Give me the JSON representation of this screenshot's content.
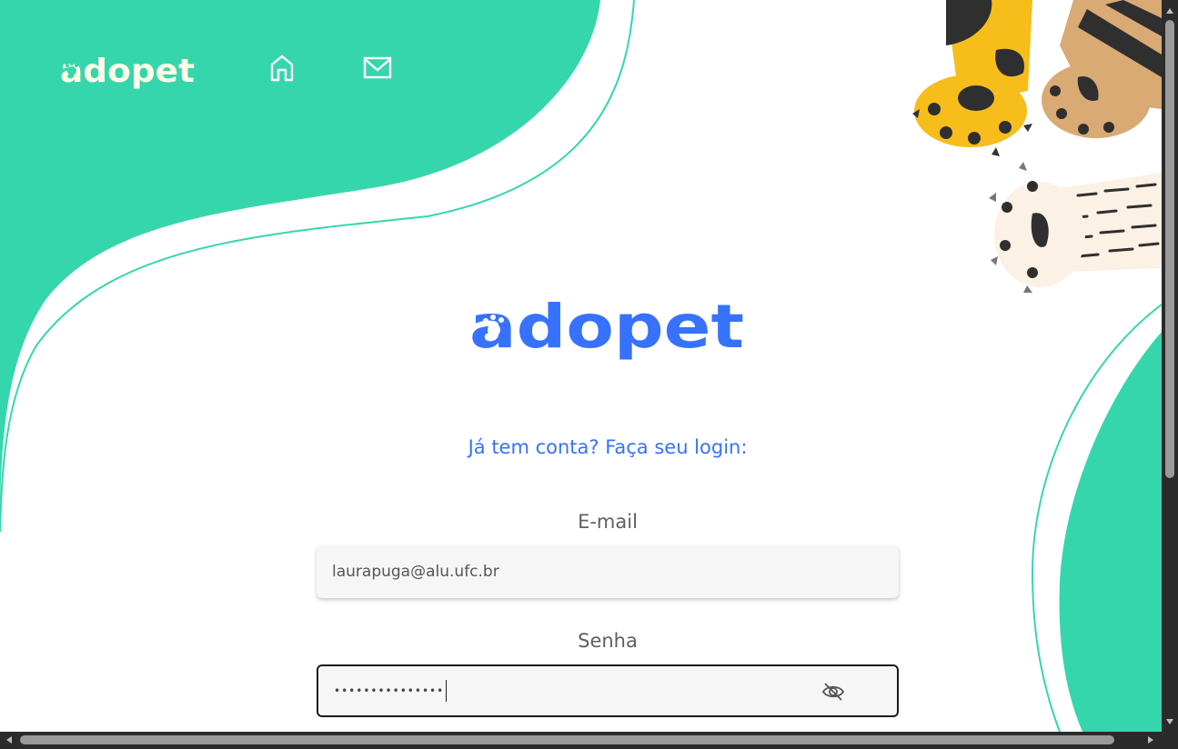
{
  "brand": {
    "name": "adopet",
    "accent": "#3772ff",
    "green": "#36d6ad",
    "nav_logo_color": "#fffbe5"
  },
  "nav": {
    "home_icon": "home-icon",
    "mail_icon": "mail-icon"
  },
  "login": {
    "tagline": "Já tem conta? Faça seu login:",
    "email": {
      "label": "E-mail",
      "value": "laurapuga@alu.ufc.br"
    },
    "password": {
      "label": "Senha",
      "masked_value": "•••••••••••••••",
      "toggle_icon": "eye-off-icon"
    }
  }
}
